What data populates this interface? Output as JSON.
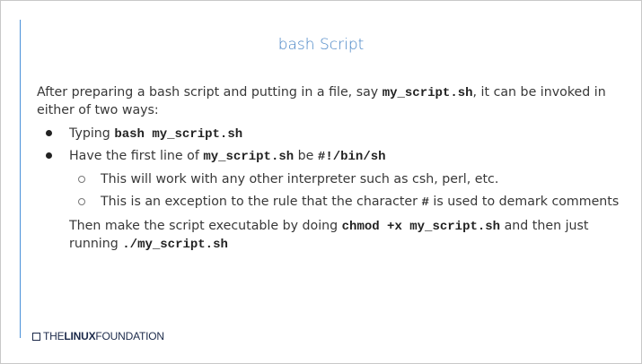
{
  "slide": {
    "title": "bash Script",
    "intro_pre": "After preparing a bash script and putting in a file, say ",
    "intro_code": "my_script.sh",
    "intro_post_line1": ", it can be invoked in",
    "intro_line2": "either of two ways:",
    "bullets": [
      {
        "pre": "Typing ",
        "code": "bash my_script.sh"
      },
      {
        "pre": "Have the first line of ",
        "code": "my_script.sh",
        "mid": " be ",
        "code2": "#!/bin/sh"
      }
    ],
    "sub_bullets": [
      {
        "text": "This will work with any other interpreter such as csh, perl, etc."
      },
      {
        "pre": "This is an exception to the rule that the character ",
        "code": "#",
        "post": " is used to demark comments"
      }
    ],
    "closing": {
      "pre": "Then make the script executable by doing ",
      "code": "chmod +x my_script.sh",
      "post": " and then just",
      "line2_pre": "running ",
      "line2_code": "./my_script.sh"
    }
  },
  "footer": {
    "logo_the": "THE",
    "logo_linux": "LINUX",
    "logo_foundation": "FOUNDATION"
  }
}
